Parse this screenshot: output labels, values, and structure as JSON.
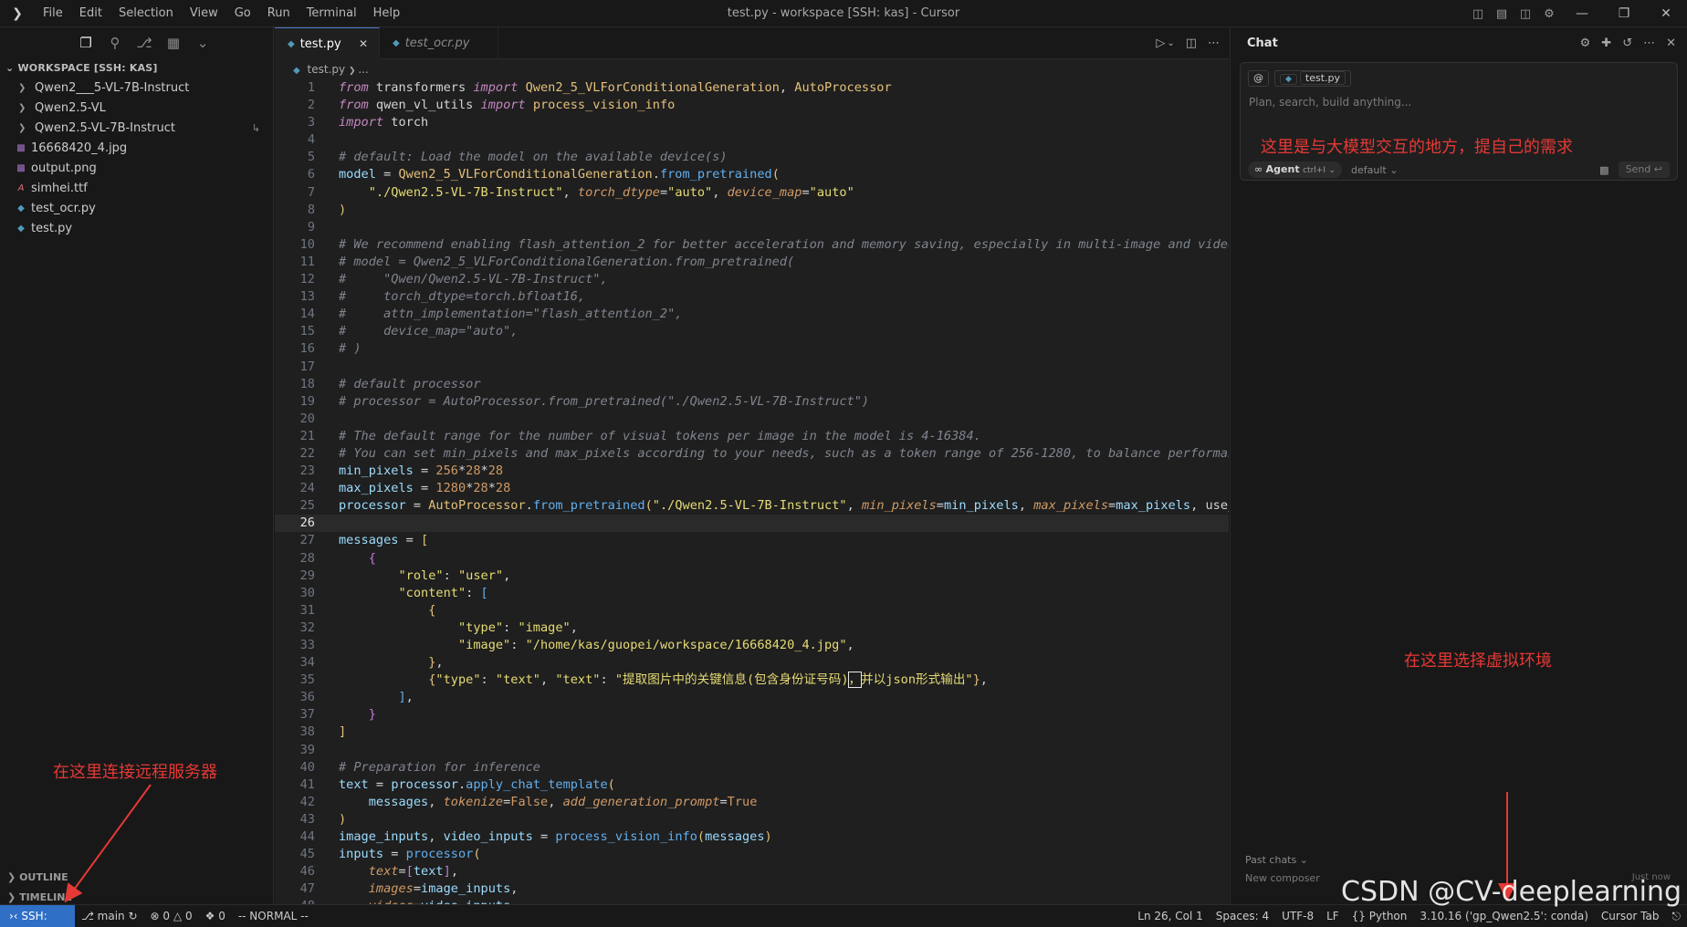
{
  "titlebar": {
    "menu": [
      "File",
      "Edit",
      "Selection",
      "View",
      "Go",
      "Run",
      "Terminal",
      "Help"
    ],
    "title": "test.py - workspace [SSH: kas] - Cursor"
  },
  "sidebar": {
    "workspace_title": "WORKSPACE [SSH: KAS]",
    "items": [
      {
        "label": "Qwen2___5-VL-7B-Instruct",
        "type": "folder"
      },
      {
        "label": "Qwen2.5-VL",
        "type": "folder"
      },
      {
        "label": "Qwen2.5-VL-7B-Instruct",
        "type": "folder",
        "modified": "↳"
      },
      {
        "label": "16668420_4.jpg",
        "type": "image"
      },
      {
        "label": "output.png",
        "type": "image"
      },
      {
        "label": "simhei.ttf",
        "type": "font"
      },
      {
        "label": "test_ocr.py",
        "type": "python"
      },
      {
        "label": "test.py",
        "type": "python"
      }
    ],
    "outline": "OUTLINE",
    "timeline": "TIMELINE"
  },
  "editor": {
    "tabs": [
      {
        "label": "test.py",
        "active": true
      },
      {
        "label": "test_ocr.py",
        "active": false
      }
    ],
    "breadcrumb": [
      "test.py",
      "..."
    ],
    "current_line": 26
  },
  "chat": {
    "title": "Chat",
    "context_at": "@",
    "context_file": "test.py",
    "placeholder": "Plan, search, build anything...",
    "agent_label": "Agent",
    "agent_shortcut": "ctrl+I",
    "model": "default",
    "send": "Send",
    "past_chats": "Past chats",
    "new_composer": "New composer",
    "just_now": "Just now"
  },
  "statusbar": {
    "remote": "SSH: kas",
    "branch": "main",
    "errors": "0",
    "warnings": "0",
    "ports": "0",
    "mode": "-- NORMAL --",
    "position": "Ln 26, Col 1",
    "spaces": "Spaces: 4",
    "encoding": "UTF-8",
    "eol": "LF",
    "language": "Python",
    "interpreter": "3.10.16 ('gp_Qwen2.5': conda)",
    "cursor_tab": "Cursor Tab"
  },
  "annotations": {
    "chat_note": "这里是与大模型交互的地方，提自己的需求",
    "remote_note": "在这里连接远程服务器",
    "env_note": "在这里选择虚拟环境"
  },
  "watermark": "CSDN @CV-deeplearning",
  "colors": {
    "accent": "#2f6fc6",
    "annotation": "#e53935",
    "background": "#1f1f1f"
  }
}
